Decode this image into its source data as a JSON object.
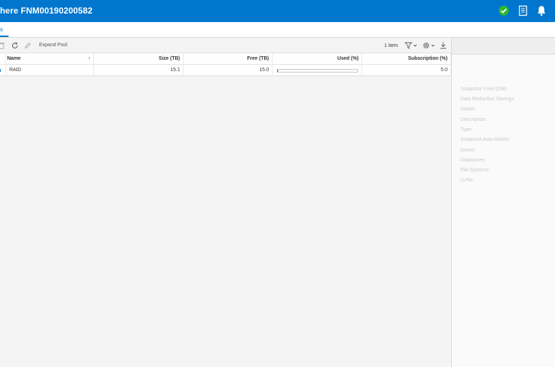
{
  "header": {
    "title": "here FNM00190200582",
    "icons": [
      "check-circle-icon",
      "document-icon",
      "bell-icon"
    ],
    "accent": "#0076ce",
    "status_color": "#2eb82e"
  },
  "tabs": [
    {
      "label": "s"
    }
  ],
  "toolbar": {
    "expand_label": "Expand Pool",
    "item_count": "1 item"
  },
  "table": {
    "columns": [
      "Name",
      "Size (TB)",
      "Free (TB)",
      "Used (%)",
      "Subscription (%)"
    ],
    "rows": [
      {
        "name": "RAID",
        "size": "15.1",
        "free": "15.0",
        "used_fraction": 0.01,
        "subscription": "5.0"
      }
    ]
  },
  "properties": [
    "Snapshot Used (GB):",
    "Data Reduction Savings:",
    "Status:",
    "Description:",
    "Type:",
    "Snapshot Auto-Delete:",
    "Drives:",
    "Datastores:",
    "File Systems:",
    "LUNs:"
  ]
}
